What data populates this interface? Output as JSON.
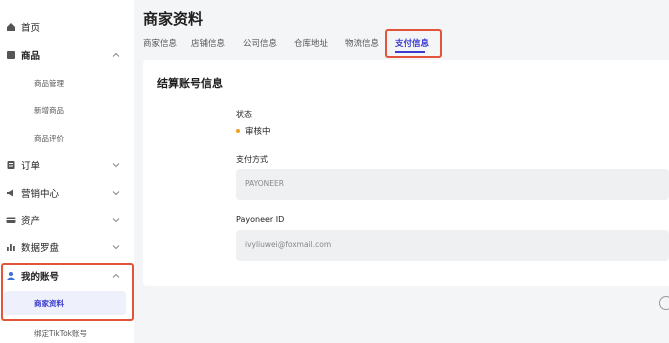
{
  "sidebar": {
    "items": [
      {
        "label": "首页",
        "icon": "home-icon"
      },
      {
        "label": "商品",
        "icon": "product-icon",
        "chevron": "up"
      },
      {
        "label": "商品管理"
      },
      {
        "label": "新增商品"
      },
      {
        "label": "商品评价"
      },
      {
        "label": "订单",
        "icon": "order-icon",
        "chevron": "down"
      },
      {
        "label": "营销中心",
        "icon": "marketing-icon",
        "chevron": "down"
      },
      {
        "label": "资产",
        "icon": "wallet-icon",
        "chevron": "down"
      },
      {
        "label": "数据罗盘",
        "icon": "chart-icon",
        "chevron": "down"
      },
      {
        "label": "我的账号",
        "icon": "account-icon",
        "chevron": "up"
      },
      {
        "label": "商家资料"
      },
      {
        "label": "绑定TikTok账号"
      }
    ]
  },
  "page": {
    "title": "商家资料",
    "tabs": [
      "商家信息",
      "店铺信息",
      "公司信息",
      "仓库地址",
      "物流信息",
      "支付信息"
    ],
    "active_tab": "支付信息"
  },
  "settlement": {
    "title": "结算账号信息",
    "status_label": "状态",
    "status_value": "审核中",
    "payment_method_label": "支付方式",
    "payment_method_value": "PAYONEER",
    "payoneer_id_label": "Payoneer ID",
    "payoneer_id_value": "ivyliuwei@foxmail.com"
  },
  "colors": {
    "accent": "#3b3ccf",
    "highlight": "#e2553b",
    "status_pending": "#f0a020"
  }
}
